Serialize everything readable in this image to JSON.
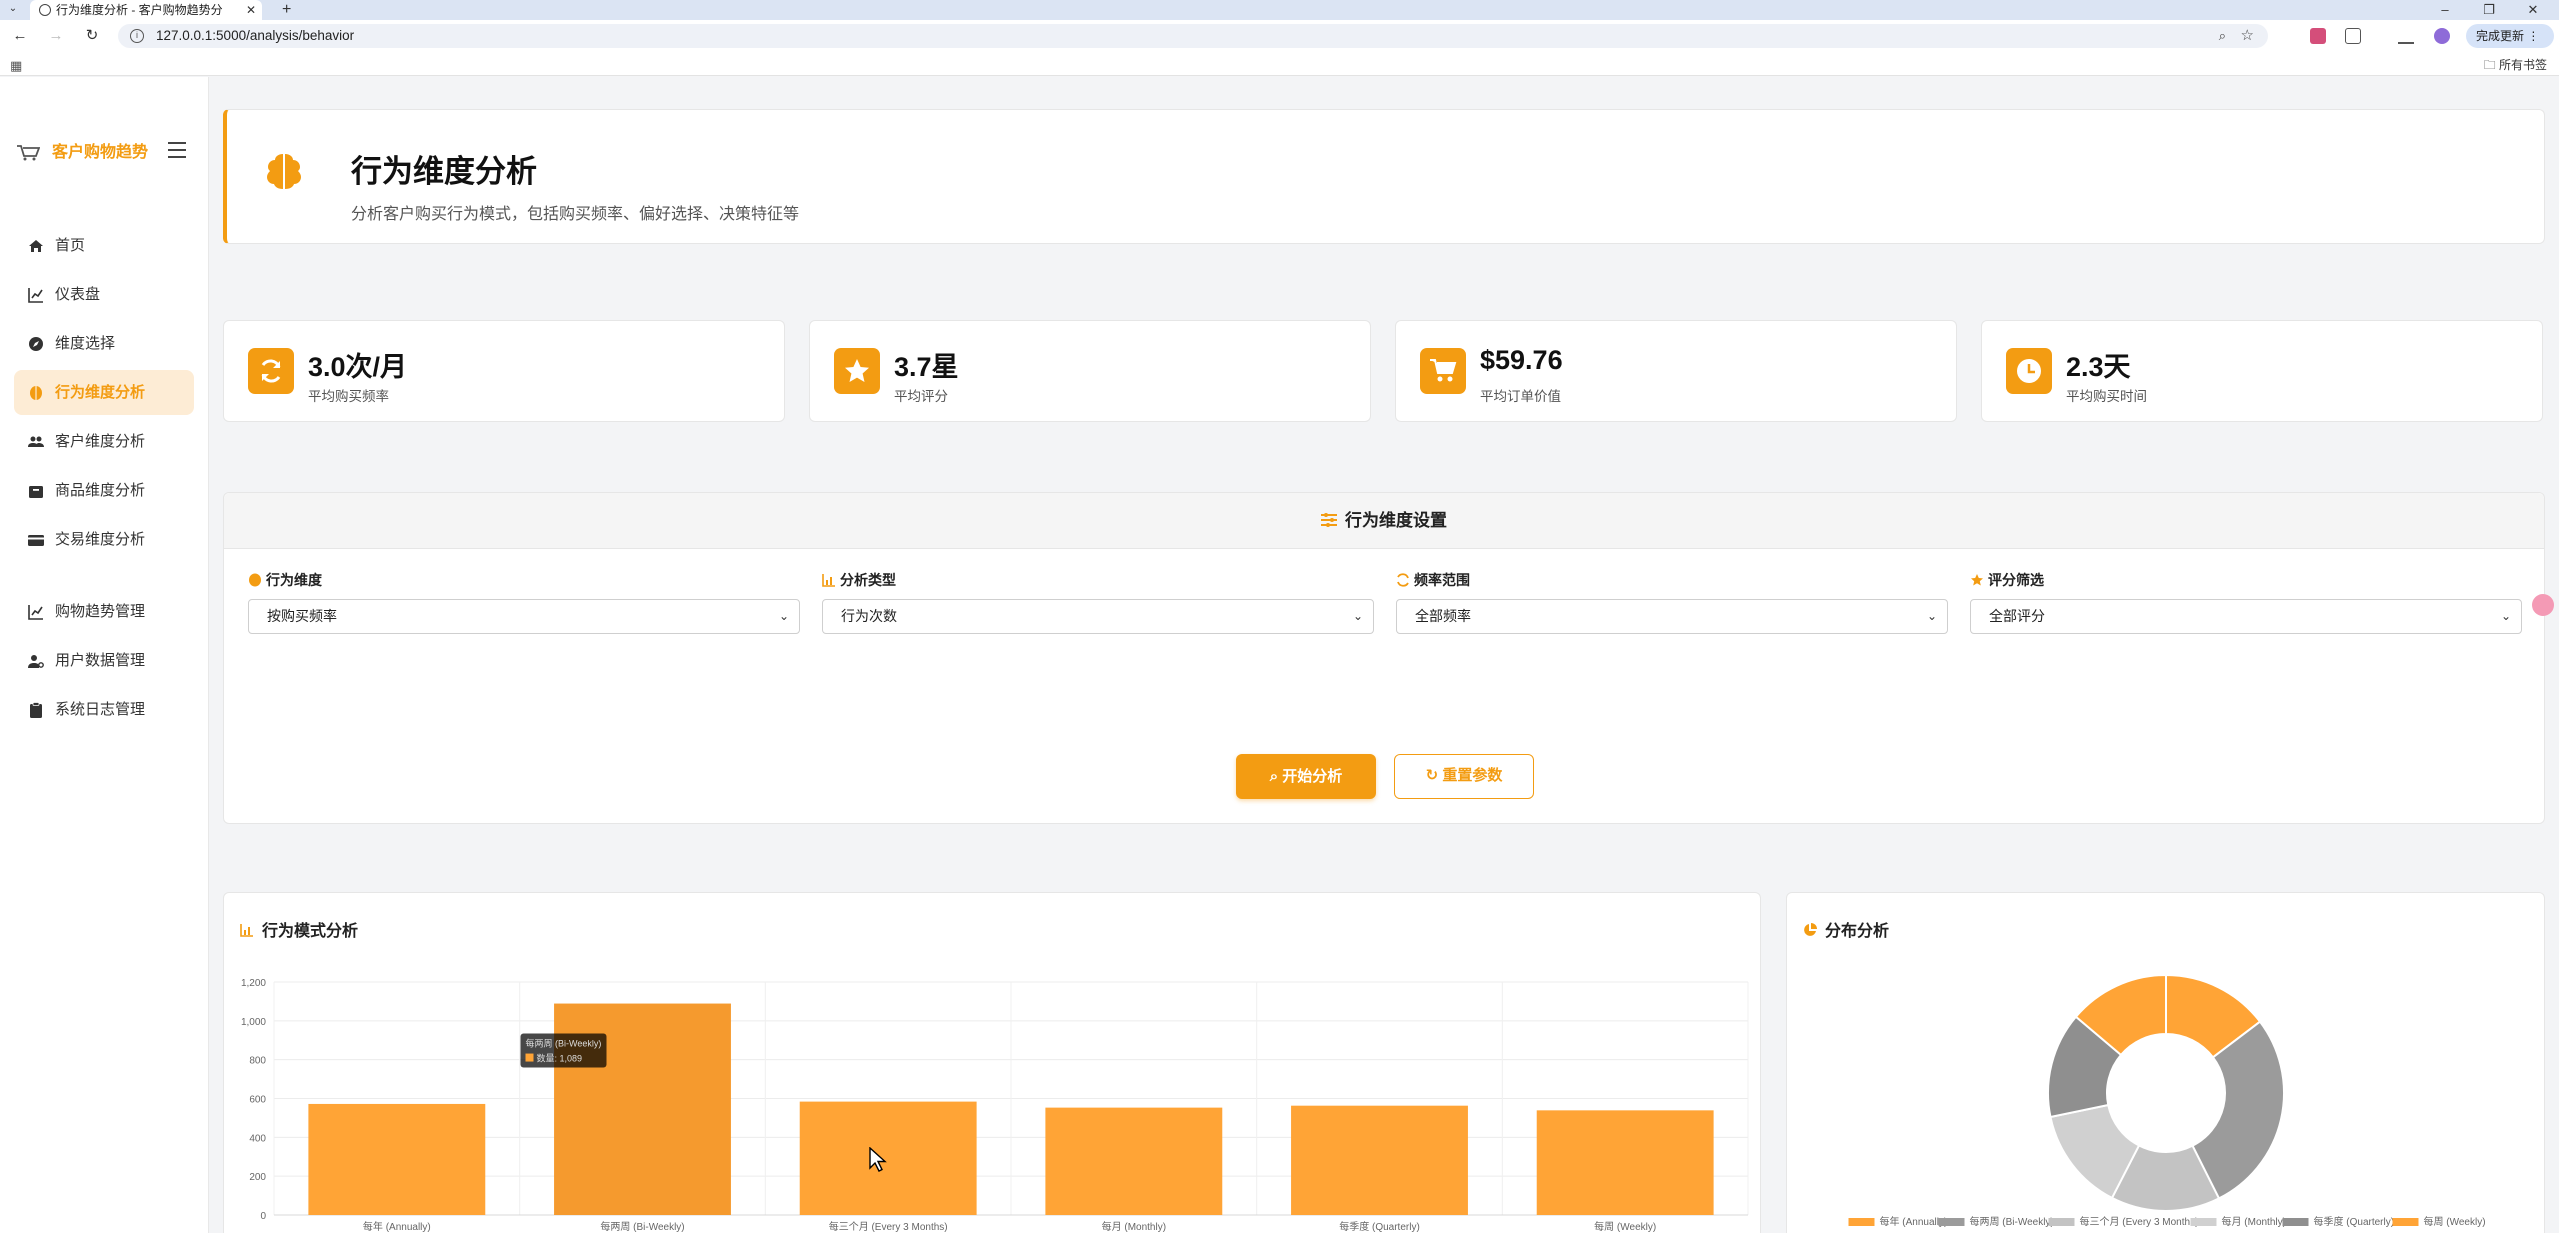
{
  "browser": {
    "tab_title": "行为维度分析 - 客户购物趋势分",
    "url": "127.0.0.1:5000/analysis/behavior",
    "update_button": "完成更新",
    "all_bookmarks": "所有书签"
  },
  "sidebar": {
    "brand": "客户购物趋势",
    "items": [
      {
        "label": "首页",
        "icon": "home-icon"
      },
      {
        "label": "仪表盘",
        "icon": "chart-line-icon"
      },
      {
        "label": "维度选择",
        "icon": "compass-icon"
      },
      {
        "label": "行为维度分析",
        "icon": "brain-icon",
        "active": true
      },
      {
        "label": "客户维度分析",
        "icon": "users-icon"
      },
      {
        "label": "商品维度分析",
        "icon": "box-icon"
      },
      {
        "label": "交易维度分析",
        "icon": "credit-card-icon"
      },
      {
        "label": "购物趋势管理",
        "icon": "chart-line-icon"
      },
      {
        "label": "用户数据管理",
        "icon": "user-gear-icon"
      },
      {
        "label": "系统日志管理",
        "icon": "clipboard-icon"
      }
    ]
  },
  "hero": {
    "title": "行为维度分析",
    "subtitle": "分析客户购买行为模式，包括购买频率、偏好选择、决策特征等"
  },
  "stats": [
    {
      "value": "3.0次/月",
      "label": "平均购买频率",
      "icon": "sync-icon"
    },
    {
      "value": "3.7星",
      "label": "平均评分",
      "icon": "star-icon"
    },
    {
      "value": "$59.76",
      "label": "平均订单价值",
      "icon": "cart-icon"
    },
    {
      "value": "2.3天",
      "label": "平均购买时间",
      "icon": "clock-icon"
    }
  ],
  "settings": {
    "title": "行为维度设置",
    "fields": [
      {
        "label": "行为维度",
        "value": "按购买频率"
      },
      {
        "label": "分析类型",
        "value": "行为次数"
      },
      {
        "label": "频率范围",
        "value": "全部频率"
      },
      {
        "label": "评分筛选",
        "value": "全部评分"
      }
    ],
    "start_button": "开始分析",
    "reset_button": "重置参数"
  },
  "bar_card_title": "行为模式分析",
  "pie_card_title": "分布分析",
  "colors": {
    "accent": "#f39c12",
    "bar": "#ffa436"
  },
  "chart_data": [
    {
      "type": "bar",
      "title": "行为模式分析",
      "categories": [
        "每年 (Annually)",
        "每两周 (Bi-Weekly)",
        "每三个月 (Every 3 Months)",
        "每月 (Monthly)",
        "每季度 (Quarterly)",
        "每周 (Weekly)"
      ],
      "values": [
        572,
        1089,
        584,
        553,
        563,
        539
      ],
      "ylim": [
        0,
        1200
      ],
      "yticks": [
        0,
        200,
        400,
        600,
        800,
        1000,
        1200
      ],
      "ytick_labels": [
        "0",
        "200",
        "400",
        "600",
        "800",
        "1,000",
        "1,200"
      ],
      "grid": true,
      "tooltip": {
        "title": "每两周 (Bi-Weekly)",
        "body": "数量: 1,089"
      }
    },
    {
      "type": "pie",
      "title": "分布分析",
      "categories": [
        "每年 (Annually)",
        "每两周 (Bi-Weekly)",
        "每三个月 (Every 3 Months)",
        "每月 (Monthly)",
        "每季度 (Quarterly)",
        "每周 (Weekly)"
      ],
      "values": [
        572,
        1089,
        584,
        553,
        563,
        539
      ],
      "colors": [
        "#ffa436",
        "#9b9b9b",
        "#c3c3c3",
        "#d0d0d0",
        "#8f8f8f",
        "#ffa436"
      ],
      "legend": "bottom"
    }
  ]
}
